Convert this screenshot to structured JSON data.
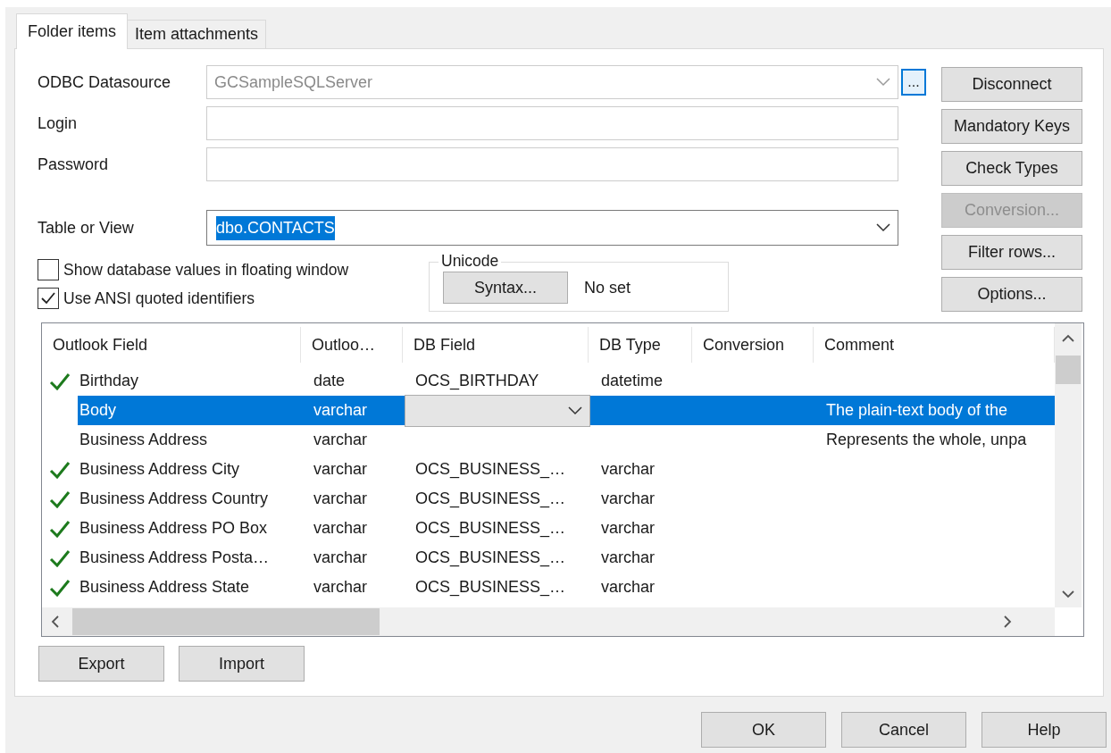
{
  "tabs": [
    {
      "label": "Folder items",
      "selected": true
    },
    {
      "label": "Item attachments",
      "selected": false
    }
  ],
  "form": {
    "datasource": {
      "label": "ODBC Datasource",
      "value": "GCSampleSQLServer",
      "disabled": true,
      "browse_button": "..."
    },
    "login": {
      "label": "Login"
    },
    "password": {
      "label": "Password"
    },
    "table_or_view": {
      "label": "Table or View",
      "value": "dbo.CONTACTS",
      "highlighted": true
    },
    "checkboxes": [
      {
        "label": "Show database values in floating window",
        "checked": false
      },
      {
        "label": "Use ANSI quoted identifiers",
        "checked": true
      }
    ],
    "unicode": {
      "title": "Unicode",
      "button": "Syntax...",
      "value": "No set"
    }
  },
  "side_buttons": [
    {
      "label": "Disconnect",
      "disabled": false
    },
    {
      "label": "Mandatory Keys",
      "disabled": false
    },
    {
      "label": "Check Types",
      "disabled": false
    },
    {
      "label": "Conversion...",
      "disabled": true
    },
    {
      "label": "Filter rows...",
      "disabled": false
    },
    {
      "label": "Options...",
      "disabled": false
    }
  ],
  "table": {
    "columns": [
      "Outlook Field",
      "Outloo…",
      "DB Field",
      "DB Type",
      "Conversion",
      "Comment"
    ],
    "rows": [
      {
        "mapped": true,
        "selected": false,
        "editing": false,
        "outlook_field": "Birthday",
        "outlook_type": "date",
        "db_field": "OCS_BIRTHDAY",
        "db_type": "datetime"
      },
      {
        "mapped": false,
        "selected": true,
        "editing": true,
        "outlook_field": "Body",
        "outlook_type": "varchar",
        "comment": "The plain-text body of the"
      },
      {
        "mapped": false,
        "selected": false,
        "editing": false,
        "outlook_field": "Business Address",
        "outlook_type": "varchar",
        "comment": "Represents the whole, unpa"
      },
      {
        "mapped": true,
        "selected": false,
        "editing": false,
        "outlook_field": "Business Address City",
        "outlook_type": "varchar",
        "db_field": "OCS_BUSINESS_…",
        "db_type": "varchar"
      },
      {
        "mapped": true,
        "selected": false,
        "editing": false,
        "outlook_field": "Business Address Country",
        "outlook_type": "varchar",
        "db_field": "OCS_BUSINESS_…",
        "db_type": "varchar"
      },
      {
        "mapped": true,
        "selected": false,
        "editing": false,
        "outlook_field": "Business Address PO Box",
        "outlook_type": "varchar",
        "db_field": "OCS_BUSINESS_…",
        "db_type": "varchar"
      },
      {
        "mapped": true,
        "selected": false,
        "editing": false,
        "outlook_field": "Business Address Posta…",
        "outlook_type": "varchar",
        "db_field": "OCS_BUSINESS_…",
        "db_type": "varchar"
      },
      {
        "mapped": true,
        "selected": false,
        "editing": false,
        "outlook_field": "Business Address State",
        "outlook_type": "varchar",
        "db_field": "OCS_BUSINESS_…",
        "db_type": "varchar"
      }
    ]
  },
  "list_buttons": [
    "Export",
    "Import"
  ],
  "dialog_buttons": [
    "OK",
    "Cancel",
    "Help"
  ]
}
